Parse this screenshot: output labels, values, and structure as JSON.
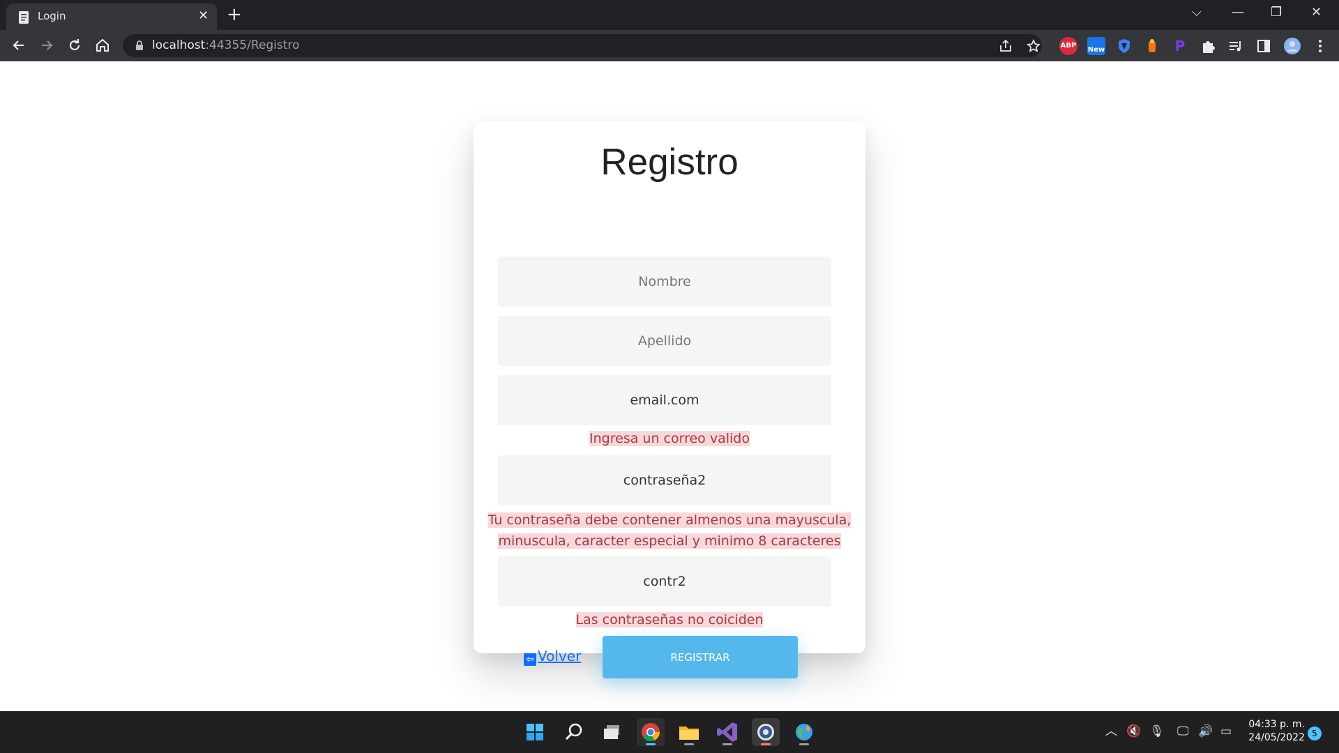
{
  "browser": {
    "tab_title": "Login",
    "tab_close": "✕",
    "new_tab": "+",
    "url_host": "localhost",
    "url_rest": ":44355/Registro",
    "window_controls": {
      "dropdown": "⌵",
      "minimize": "—",
      "restore": "❐",
      "close": "✕"
    },
    "extensions": [
      {
        "name": "adblock-plus",
        "label": "ABP",
        "color": "#e0283c"
      },
      {
        "name": "new-extension",
        "label": "New",
        "color": "#1a73e8"
      },
      {
        "name": "shield-extension",
        "label": "",
        "color": "#3b82f6"
      },
      {
        "name": "orange-extension",
        "label": "",
        "color": "#f97316"
      },
      {
        "name": "p-extension",
        "label": "P",
        "color": "#7c3aed"
      }
    ]
  },
  "form": {
    "title": "Registro",
    "nombre_placeholder": "Nombre",
    "apellido_placeholder": "Apellido",
    "email_value": "email.com",
    "email_error": "Ingresa un correo valido",
    "password_value": "contraseña2",
    "password_error_line1": "Tu contraseña debe contener almenos una mayuscula,",
    "password_error_line2": "minuscula, caracter especial y minimo 8 caracteres",
    "confirm_value": "contr2",
    "confirm_error": "Las contraseñas no coiciden",
    "back_link": "Volver",
    "submit_label": "REGISTRAR"
  },
  "taskbar": {
    "time": "04:33 p. m.",
    "date": "24/05/2022",
    "notification_count": "5",
    "apps": [
      "start",
      "search",
      "task-view",
      "chrome",
      "file-explorer",
      "visual-studio",
      "obs",
      "browser-globe"
    ]
  },
  "colors": {
    "accent_button": "#55b8ec",
    "error_bg": "#f8d7da",
    "error_text": "#a53b45",
    "link": "#0d6efd"
  }
}
